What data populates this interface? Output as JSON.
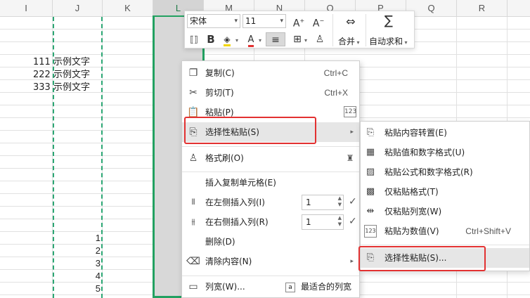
{
  "columns": [
    "I",
    "J",
    "K",
    "L",
    "M",
    "N",
    "O",
    "P",
    "Q",
    "R"
  ],
  "cells": {
    "text_rows": [
      "111 示例文字",
      "222 示例文字",
      "333 示例文字"
    ],
    "numbers": [
      "1",
      "2",
      "3",
      "4",
      "5"
    ]
  },
  "toolbar": {
    "font_name": "宋体",
    "font_size": "11",
    "increase_font_icon": "A⁺",
    "decrease_font_icon": "A⁻",
    "merge_label": "合并",
    "autosum_label": "自动求和",
    "bold_icon": "B",
    "font_color_icon": "A"
  },
  "context_menu": {
    "copy": {
      "label": "复制(C)",
      "shortcut": "Ctrl+C"
    },
    "cut": {
      "label": "剪切(T)",
      "shortcut": "Ctrl+X"
    },
    "paste": {
      "label": "粘贴(P)"
    },
    "paste_special": {
      "label": "选择性粘贴(S)"
    },
    "format_painter": {
      "label": "格式刷(O)"
    },
    "insert_copied_cells": {
      "label": "插入复制单元格(E)"
    },
    "insert_left": {
      "label": "在左侧插入列(I)",
      "value": "1"
    },
    "insert_right": {
      "label": "在右侧插入列(R)",
      "value": "1"
    },
    "delete": {
      "label": "删除(D)"
    },
    "clear_contents": {
      "label": "清除内容(N)"
    },
    "column_width": {
      "label": "列宽(W)...",
      "best_fit": "最适合的列宽"
    }
  },
  "submenu": {
    "items": [
      {
        "label": "粘贴内容转置(E)",
        "shortcut": ""
      },
      {
        "label": "粘贴值和数字格式(U)",
        "shortcut": ""
      },
      {
        "label": "粘贴公式和数字格式(R)",
        "shortcut": ""
      },
      {
        "label": "仅粘贴格式(T)",
        "shortcut": ""
      },
      {
        "label": "仅粘贴列宽(W)",
        "shortcut": ""
      },
      {
        "label": "粘贴为数值(V)",
        "shortcut": "Ctrl+Shift+V"
      },
      {
        "label": "选择性粘贴(S)...",
        "shortcut": ""
      }
    ]
  },
  "colors": {
    "selection_green": "#22a161",
    "highlight_red": "#e23131",
    "menu_hover": "#e6e6e6"
  }
}
